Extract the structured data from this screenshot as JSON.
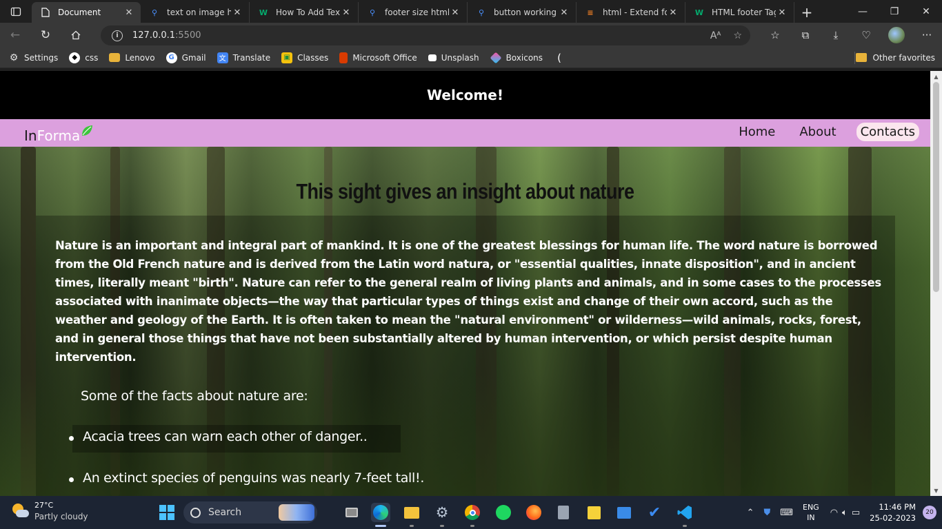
{
  "browser": {
    "tabs": [
      {
        "title": "Document",
        "favicon": "document-icon",
        "active": true
      },
      {
        "title": "text on image htm",
        "favicon": "search-icon"
      },
      {
        "title": "How To Add Text",
        "favicon": "w3schools-icon"
      },
      {
        "title": "footer size html -",
        "favicon": "search-icon"
      },
      {
        "title": "button working o",
        "favicon": "search-icon"
      },
      {
        "title": "html - Extend foo",
        "favicon": "stackoverflow-icon"
      },
      {
        "title": "HTML footer Tag",
        "favicon": "w3schools-icon"
      }
    ],
    "url_host": "127.0.0.1",
    "url_port": ":5500",
    "favorites": [
      {
        "label": "Settings",
        "icon": "gear-icon"
      },
      {
        "label": "css",
        "icon": "css-icon"
      },
      {
        "label": "Lenovo",
        "icon": "folder-icon"
      },
      {
        "label": "Gmail",
        "icon": "google-icon"
      },
      {
        "label": "Translate",
        "icon": "translate-icon"
      },
      {
        "label": "Classes",
        "icon": "classroom-icon"
      },
      {
        "label": "Microsoft Office",
        "icon": "office-icon"
      },
      {
        "label": "Unsplash",
        "icon": "unsplash-icon"
      },
      {
        "label": "Boxicons",
        "icon": "boxicons-icon"
      }
    ],
    "other_favorites": "Other favorites"
  },
  "page": {
    "welcome": "Welcome!",
    "brand_in": "In",
    "brand_forma": "Forma",
    "nav": [
      {
        "label": "Home",
        "active": false
      },
      {
        "label": "About",
        "active": false
      },
      {
        "label": "Contacts",
        "active": true
      }
    ],
    "hero_title": "This sight gives an insight about nature",
    "hero_paragraph": "Nature is an important and integral part of mankind. It is one of the greatest blessings for human life. The word nature is borrowed from the Old French nature and is derived from the Latin word natura, or \"essential qualities, innate disposition\", and in ancient times, literally meant \"birth\". Nature can refer to the general realm of living plants and animals, and in some cases to the processes associated with inanimate objects—the way that particular types of things exist and change of their own accord, such as the weather and geology of the Earth. It is often taken to mean the \"natural environment\" or wilderness—wild animals, rocks, forest, and in general those things that have not been substantially altered by human intervention, or which persist despite human intervention.",
    "facts_heading": "Some of the facts about nature are:",
    "facts": [
      "Acacia trees can warn each other of danger..",
      "An extinct species of penguins was nearly 7-feet tall!."
    ]
  },
  "taskbar": {
    "temperature": "27°C",
    "weather": "Partly cloudy",
    "search_label": "Search",
    "lang_top": "ENG",
    "lang_bottom": "IN",
    "time": "11:46 PM",
    "date": "25-02-2023",
    "notification_count": "20"
  },
  "colors": {
    "nav_bg": "#dca0de",
    "welcome_bg": "#000000",
    "active_link_bg": "#fbe6ee",
    "taskbar_bg": "#1c2433"
  }
}
